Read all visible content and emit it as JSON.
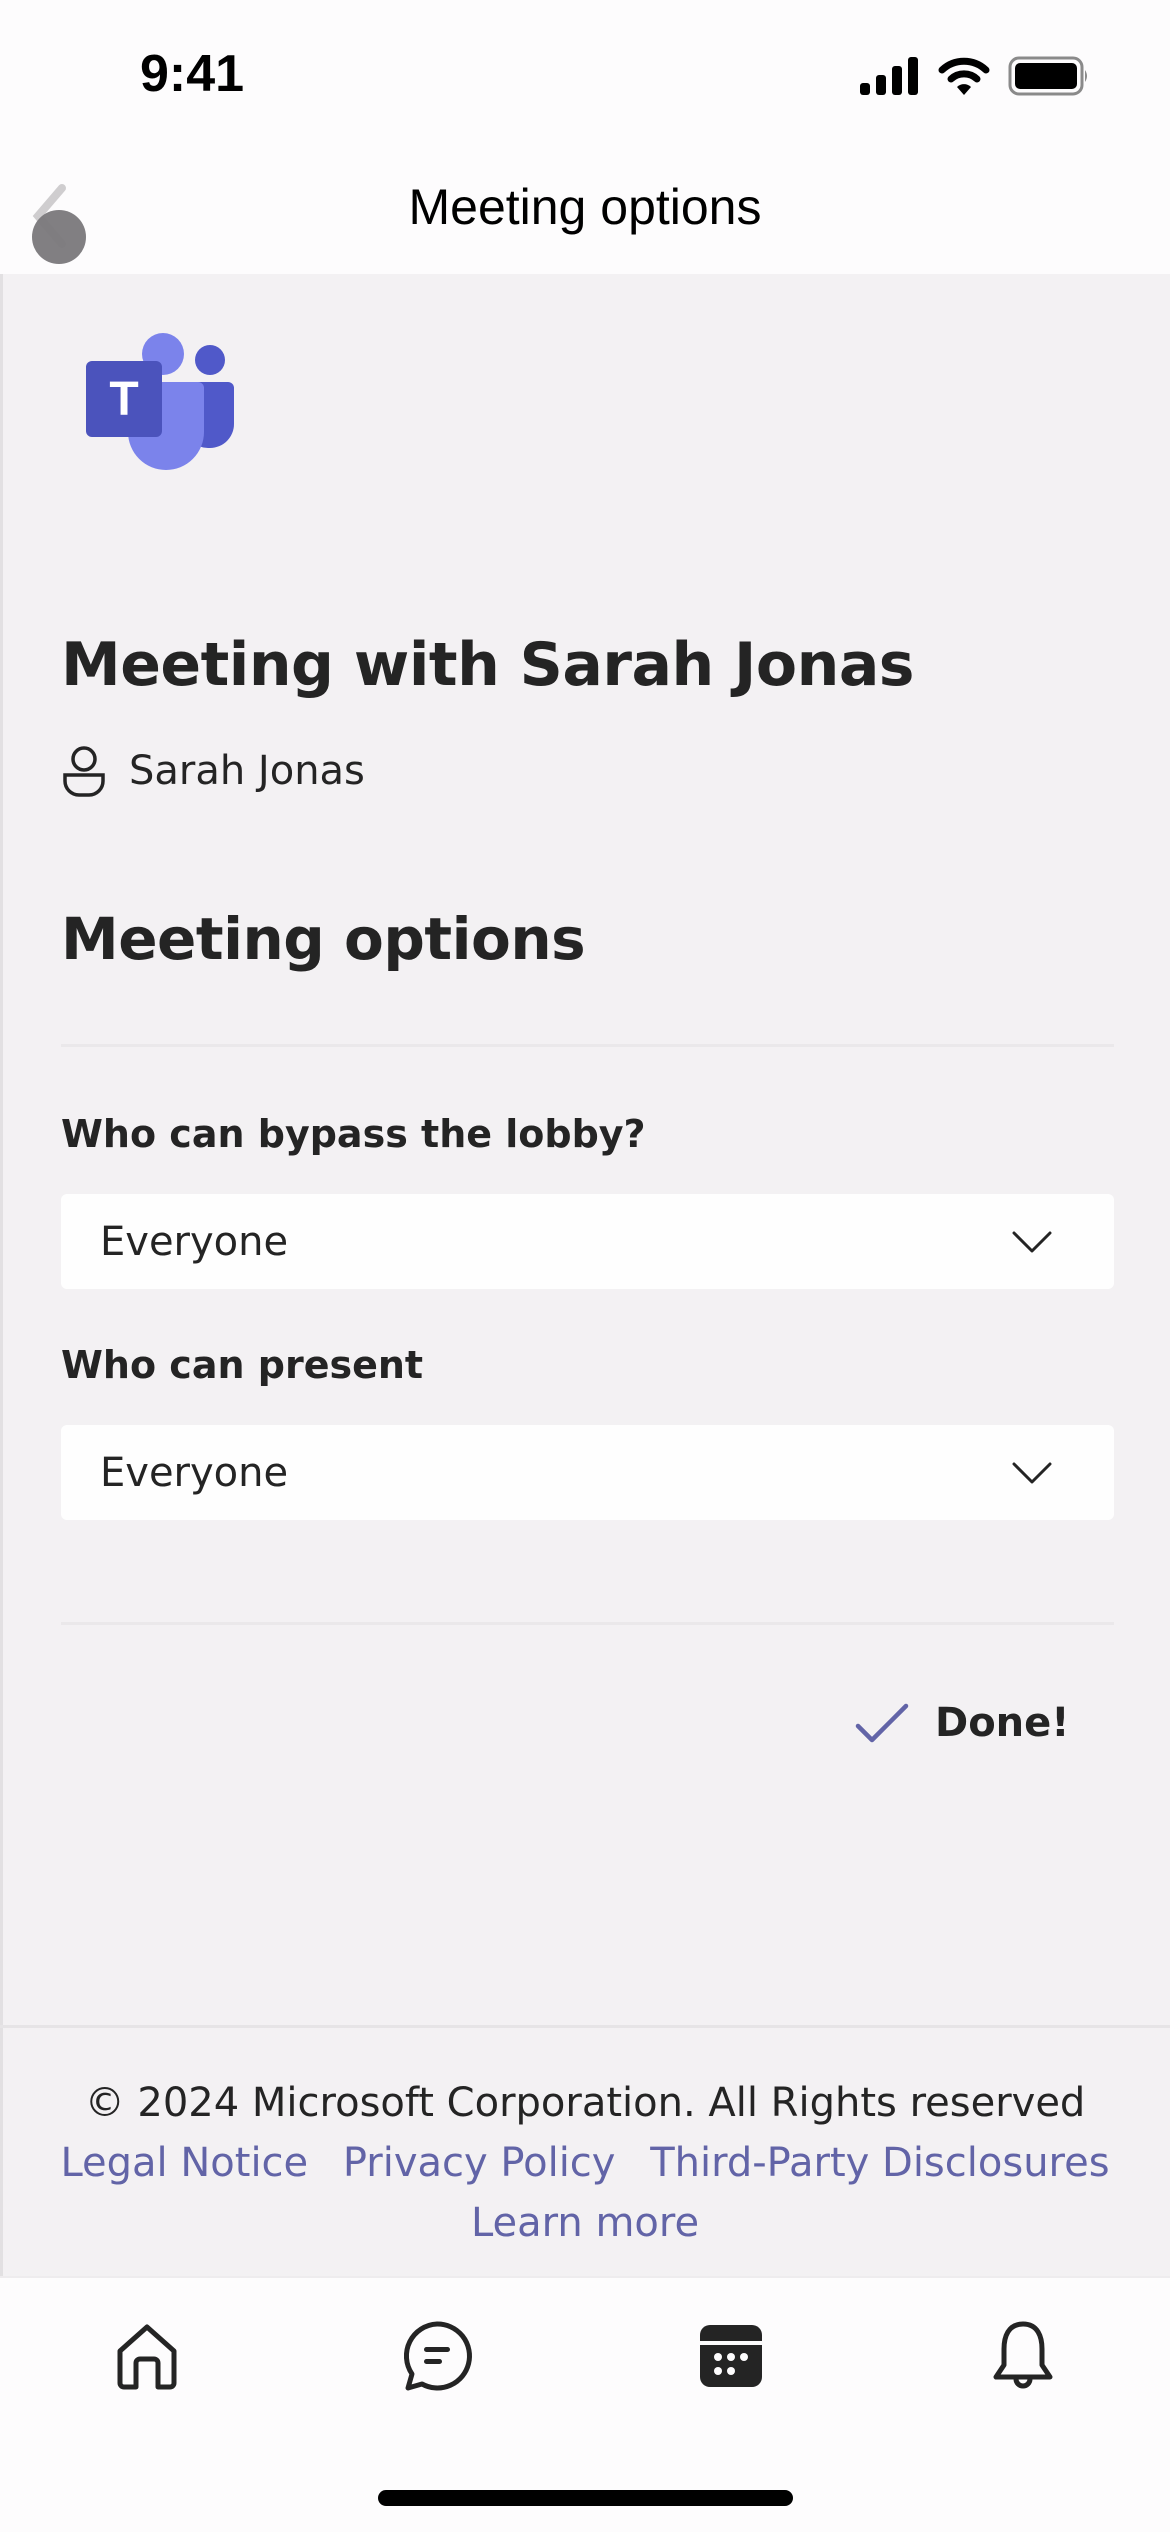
{
  "status_bar": {
    "time": "9:41",
    "icons": [
      "cellular-signal-icon",
      "wifi-icon",
      "battery-icon"
    ]
  },
  "nav": {
    "title": "Meeting options",
    "back_icon": "chevron-left-icon"
  },
  "app": {
    "logo": "microsoft-teams-logo",
    "logo_letter": "T",
    "brand_color": "#5b5fc7"
  },
  "meeting": {
    "title": "Meeting with Sarah Jonas",
    "organizer": "Sarah Jonas",
    "organizer_icon": "person-icon"
  },
  "options": {
    "section_title": "Meeting options",
    "fields": [
      {
        "label": "Who can bypass the lobby?",
        "value": "Everyone",
        "icon": "chevron-down-icon"
      },
      {
        "label": "Who can present",
        "value": "Everyone",
        "icon": "chevron-down-icon"
      }
    ],
    "done_label": "Done!",
    "done_icon": "checkmark-icon",
    "accent_color": "#6264a7"
  },
  "footer": {
    "copyright": "© 2024 Microsoft Corporation. All Rights reserved",
    "links": [
      "Legal Notice",
      "Privacy Policy",
      "Third-Party Disclosures"
    ],
    "learn_more": "Learn more",
    "link_color": "#6264a7"
  },
  "tab_bar": {
    "tabs": [
      {
        "name": "home",
        "icon": "home-icon"
      },
      {
        "name": "chat",
        "icon": "chat-icon"
      },
      {
        "name": "calendar",
        "icon": "calendar-icon",
        "active": true
      },
      {
        "name": "activity",
        "icon": "bell-icon"
      }
    ]
  }
}
